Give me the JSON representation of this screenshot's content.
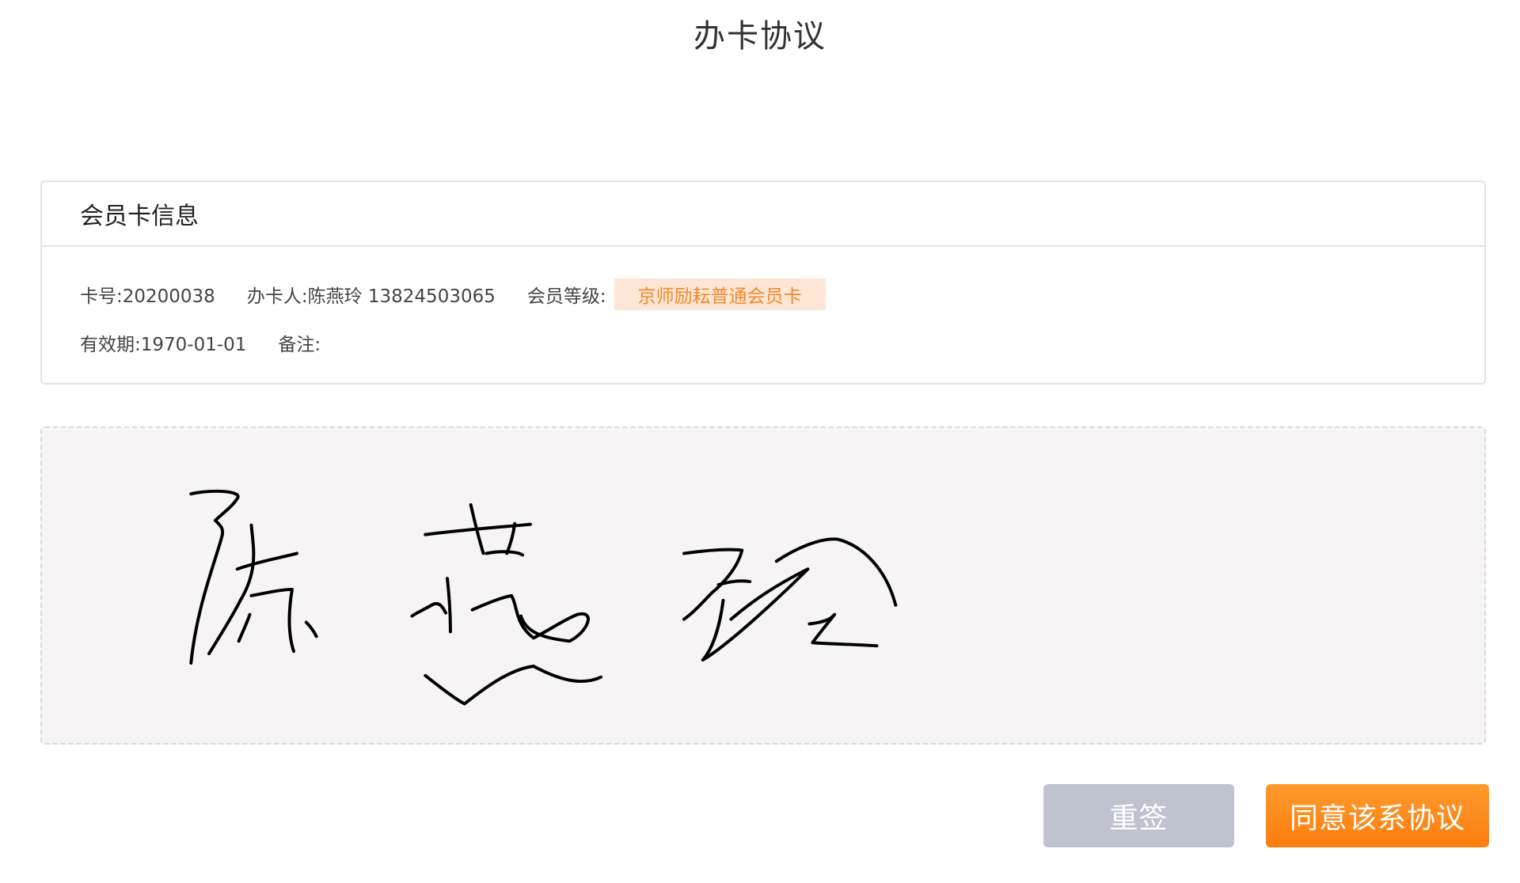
{
  "page": {
    "title": "办卡协议"
  },
  "card_info": {
    "header": "会员卡信息",
    "card_number": "卡号:20200038",
    "applicant": "办卡人:陈燕玲 13824503065",
    "level_label": "会员等级:",
    "level_value": "京师励耘普通会员卡",
    "validity": "有效期:1970-01-01",
    "remark": "备注:"
  },
  "signature": {
    "ink_color": "#000000",
    "background_color": "#f7f4f6"
  },
  "actions": {
    "reset_label": "重签",
    "agree_label": "同意该系协议"
  },
  "colors": {
    "accent": "#fb7d0d",
    "badge_bg": "#fde6d5",
    "badge_text": "#f08a2c",
    "reset_bg": "#bfc3cf"
  }
}
